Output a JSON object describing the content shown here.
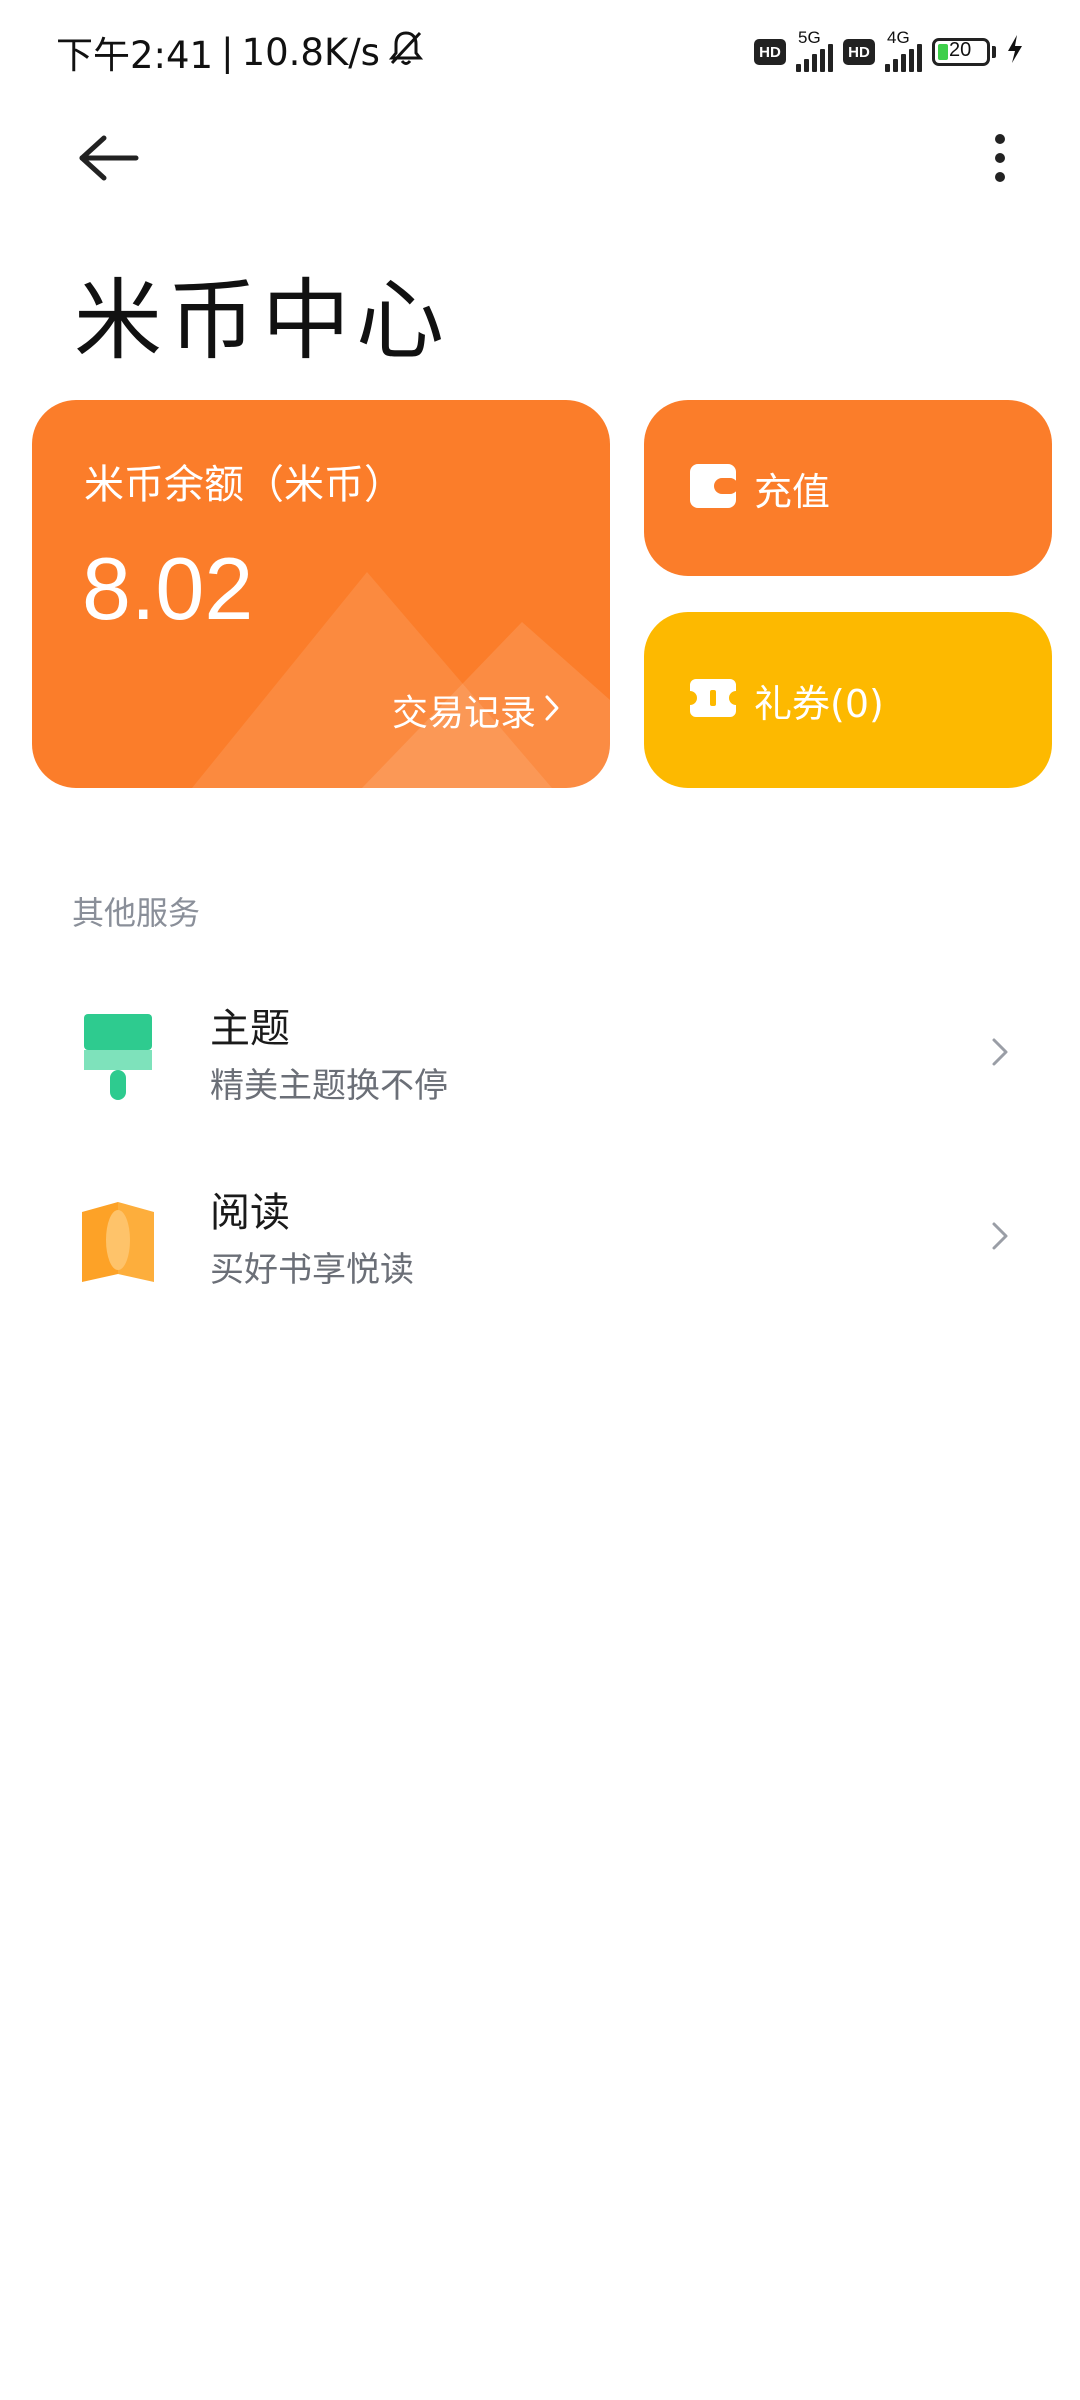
{
  "status_bar": {
    "time": "下午2:41",
    "separator": "|",
    "speed": "10.8K/s",
    "hd1": "HD",
    "net1": "5G",
    "hd2": "HD",
    "net2": "4G",
    "battery": "20"
  },
  "icons": {
    "back": "arrow-left-icon",
    "more": "more-vertical-icon",
    "mute": "bell-off-icon",
    "wallet": "wallet-icon",
    "ticket": "ticket-icon",
    "theme": "paint-brush-icon",
    "read": "book-icon",
    "chevron": "chevron-right-icon"
  },
  "page": {
    "title": "米币中心"
  },
  "balance": {
    "label": "米币余额（米币）",
    "value": "8.02",
    "records_label": "交易记录"
  },
  "actions": {
    "recharge_label": "充值",
    "coupon_label": "礼券(0)"
  },
  "services": {
    "section_label": "其他服务",
    "items": [
      {
        "title": "主题",
        "desc": "精美主题换不停"
      },
      {
        "title": "阅读",
        "desc": "买好书享悦读"
      }
    ]
  },
  "colors": {
    "orange": "#fb7d2a",
    "yellow": "#fdb900",
    "theme_green": "#2ecb8f",
    "read_orange": "#fda227",
    "muted_text": "#8a8f99"
  }
}
